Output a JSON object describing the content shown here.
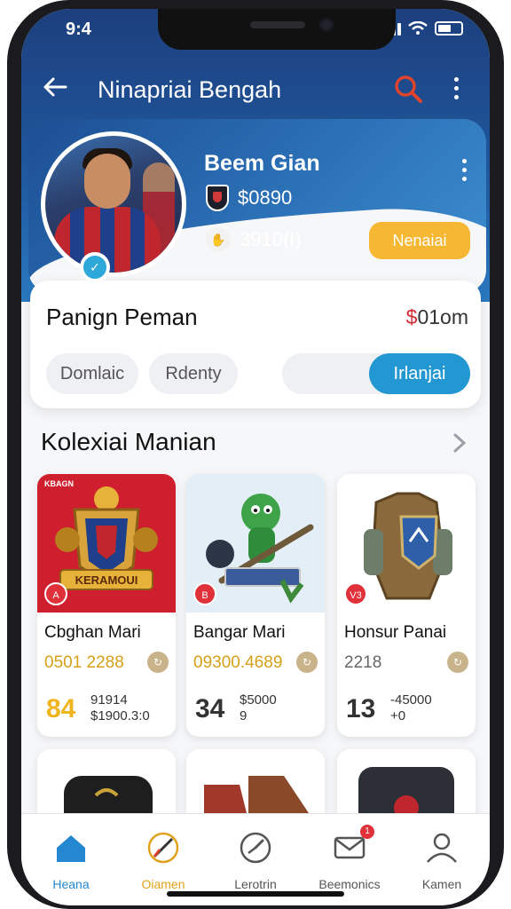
{
  "status_bar": {
    "time": "9:4",
    "icons": [
      "signal-icon",
      "wifi-icon",
      "battery-icon"
    ]
  },
  "app_bar": {
    "title": "Ninapriai Bengah",
    "back_icon": "arrow-left-icon",
    "search_icon": "search-icon",
    "more_icon": "more-vertical-icon",
    "search_color": "#e0442e"
  },
  "profile": {
    "name": "Beem Gian",
    "stat1_value": "$0890",
    "stat2_value": "3910(I)",
    "action_label": "Nenaiai",
    "action_color": "#f6b733",
    "verified_icon": "verified-icon"
  },
  "stats_card": {
    "title": "Panign Peman",
    "value": "$01om",
    "value_currency": "$",
    "value_rest": "01om",
    "chips": [
      "Domlaic",
      "Rdenty"
    ],
    "toggle_label": "Irlanjai",
    "accent": "#2297d1"
  },
  "collection": {
    "title": "Kolexiai Manian",
    "chevron_icon": "chevron-right-icon",
    "items": [
      {
        "thumb_tag": "KBAGN",
        "emblem_text": "KERAMOUI",
        "badge": "A",
        "name": "Cbghan Mari",
        "price": "0501 2288",
        "big": "84",
        "line1": "91914",
        "line2": "$1900.3:0"
      },
      {
        "badge": "B",
        "name": "Bangar Mari",
        "price": "09300.4689",
        "big": "34",
        "line1": "$5000",
        "line2": "9"
      },
      {
        "badge": "V3",
        "name": "Honsur Panai",
        "price": "2218",
        "big": "13",
        "line1": "-45000",
        "line2": "+0"
      }
    ]
  },
  "bottom_nav": [
    {
      "label": "Heana",
      "icon": "home-icon"
    },
    {
      "label": "Oiamen",
      "icon": "compass-icon"
    },
    {
      "label": "Lerotrin",
      "icon": "gauge-icon"
    },
    {
      "label": "Beemonics",
      "icon": "mail-icon",
      "badge": "1"
    },
    {
      "label": "Kamen",
      "icon": "user-icon"
    }
  ]
}
